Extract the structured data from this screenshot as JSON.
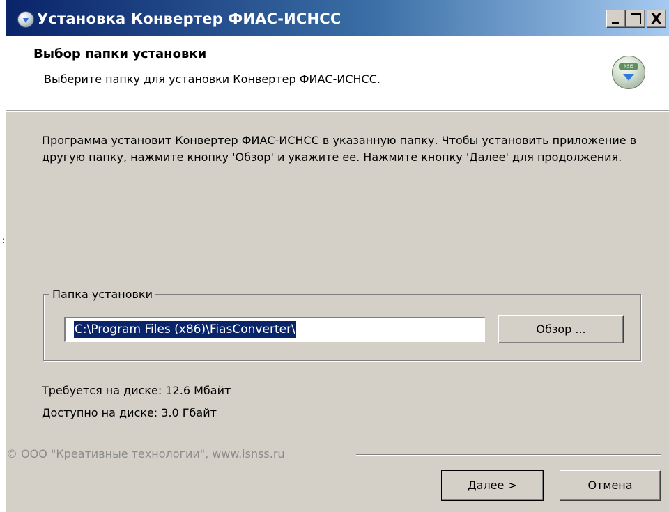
{
  "window": {
    "title": "Установка Конвертер ФИАС-ИСНСС",
    "caption_buttons": [
      "minimize",
      "maximize",
      "close"
    ],
    "close_glyph": "X"
  },
  "header": {
    "title": "Выбор папки установки",
    "subtitle": "Выберите папку для установки Конвертер ФИАС-ИСНСС.",
    "icon": "installer-disc-icon",
    "icon_badge": "NSIS"
  },
  "body": {
    "instructions": "Программа установит Конвертер ФИАС-ИСНСС в указанную папку. Чтобы установить приложение в другую папку, нажмите кнопку 'Обзор' и укажите ее. Нажмите кнопку 'Далее' для продолжения.",
    "install_folder": {
      "label": "Папка установки",
      "value": "C:\\Program Files (x86)\\FiasConverter\\",
      "browse_label": "Обзор ..."
    },
    "space_required": "Требуется на диске: 12.6 Мбайт",
    "space_available": "Доступно на диске: 3.0 Гбайт"
  },
  "footer": {
    "branding": "© ООО \"Креативные технологии\", www.isnss.ru",
    "next_label": "Далее >",
    "cancel_label": "Отмена"
  },
  "colors": {
    "titlebar_start": "#0a246a",
    "titlebar_end": "#a6caf0",
    "dialog_face": "#d4d0c8",
    "selection": "#0a246a"
  }
}
